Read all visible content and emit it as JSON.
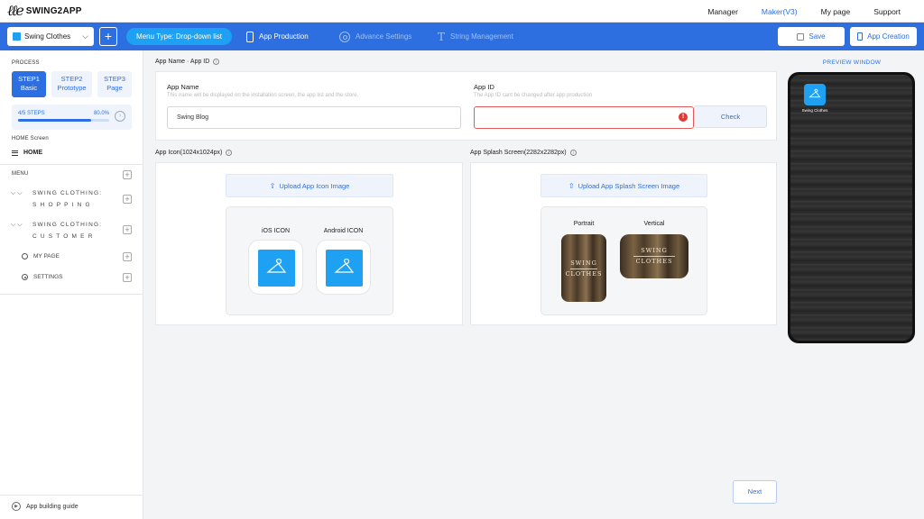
{
  "brand": {
    "name": "SWING2APP"
  },
  "topnav": [
    {
      "label": "Manager",
      "active": false
    },
    {
      "label": "Maker(V3)",
      "active": true
    },
    {
      "label": "My page",
      "active": false
    },
    {
      "label": "Support",
      "active": false
    }
  ],
  "toolbar": {
    "app_name": "Swing Clothes",
    "plus": "+",
    "menu_type": "Menu Type:  Drop-down list",
    "tabs": [
      {
        "label": "App Production",
        "active": true
      },
      {
        "label": "Advance Settings",
        "active": false
      },
      {
        "label": "String Management",
        "active": false
      }
    ],
    "save": "Save",
    "create": "App Creation"
  },
  "sidebar": {
    "process_label": "PROCESS",
    "steps": [
      {
        "line1": "STEP1",
        "line2": "Basic",
        "active": true
      },
      {
        "line1": "STEP2",
        "line2": "Prototype",
        "active": false
      },
      {
        "line1": "STEP3",
        "line2": "Page",
        "active": false
      }
    ],
    "progress": {
      "steps_text": "4/5 STEPS",
      "percent_text": "80.0%",
      "fraction": 0.8
    },
    "home_label": "HOME Screen",
    "home_item": "HOME",
    "menu_label": "MENU",
    "menu_items": [
      {
        "label": "SWING CLOTHING: S H O P P I N G"
      },
      {
        "label": "SWING CLOTHING: C U S T O M E R"
      },
      {
        "label": "MY PAGE"
      },
      {
        "label": "SETTINGS"
      }
    ],
    "guide": "App building guide"
  },
  "main": {
    "name_section_title": "App Name · App ID",
    "app_name": {
      "label": "App Name",
      "hint": "This name will be displayed on the installation screen, the app list and the store.",
      "value": "Swing Blog"
    },
    "app_id": {
      "label": "App ID",
      "hint": "The App ID cant be changed after app production",
      "value": "",
      "check": "Check"
    },
    "icon_section_title": "App Icon(1024x1024px)",
    "splash_section_title": "App Splash Screen(2282x2282px)",
    "upload_icon": "Upload App Icon Image",
    "upload_splash": "Upload App Splash Screen Image",
    "ios_icon": "iOS ICON",
    "android_icon": "Android ICON",
    "portrait": "Portrait",
    "vertical": "Vertical",
    "splash_text_1": "SWING",
    "splash_text_2": "CLOTHES",
    "next": "Next"
  },
  "preview": {
    "label": "PREVIEW WINDOW",
    "app_label": "Swing Clothes"
  },
  "colors": {
    "accent": "#2d6fe0",
    "app_icon": "#1ea0f3",
    "error": "#e53935"
  }
}
